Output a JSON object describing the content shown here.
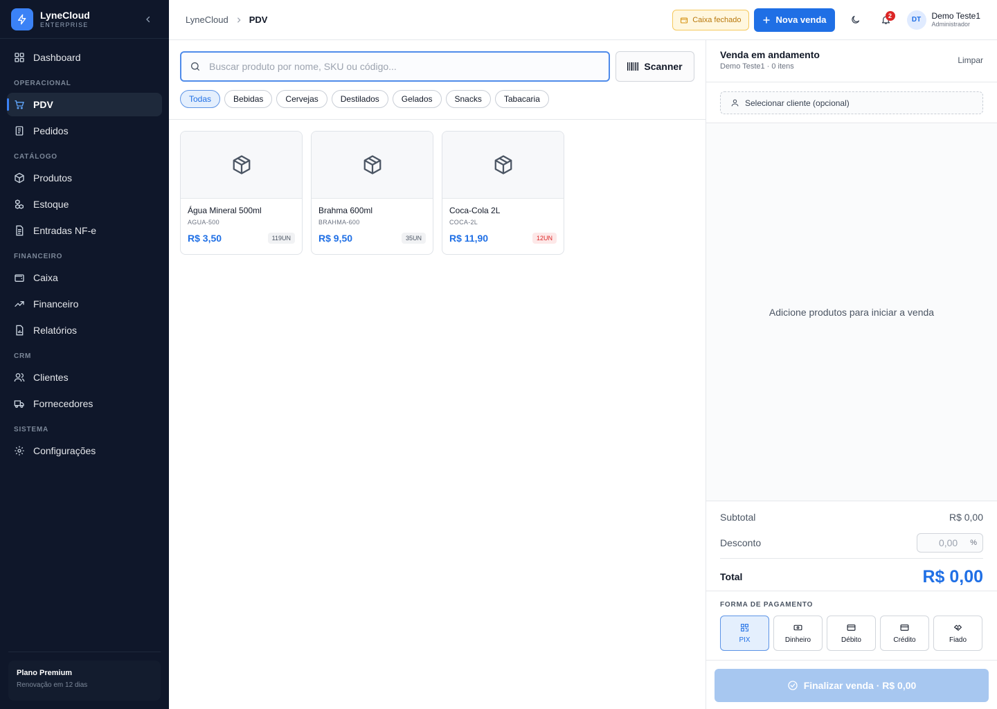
{
  "brand": {
    "name": "LyneCloud",
    "edition": "ENTERPRISE"
  },
  "sidebar": {
    "top_item": {
      "label": "Dashboard",
      "icon": "dashboard-icon"
    },
    "sections": [
      {
        "title": "OPERACIONAL",
        "items": [
          {
            "label": "PDV",
            "icon": "cart-icon",
            "active": true
          },
          {
            "label": "Pedidos",
            "icon": "receipt-icon"
          }
        ]
      },
      {
        "title": "CATÁLOGO",
        "items": [
          {
            "label": "Produtos",
            "icon": "box-icon"
          },
          {
            "label": "Estoque",
            "icon": "boxes-icon"
          },
          {
            "label": "Entradas NF-e",
            "icon": "document-icon"
          }
        ]
      },
      {
        "title": "FINANCEIRO",
        "items": [
          {
            "label": "Caixa",
            "icon": "wallet-icon"
          },
          {
            "label": "Financeiro",
            "icon": "trend-icon"
          },
          {
            "label": "Relatórios",
            "icon": "report-icon"
          }
        ]
      },
      {
        "title": "CRM",
        "items": [
          {
            "label": "Clientes",
            "icon": "users-icon"
          },
          {
            "label": "Fornecedores",
            "icon": "truck-icon"
          }
        ]
      },
      {
        "title": "SISTEMA",
        "items": [
          {
            "label": "Configurações",
            "icon": "gear-icon"
          }
        ]
      }
    ],
    "plan": {
      "title": "Plano Premium",
      "renewal": "Renovação em 12 dias"
    }
  },
  "header": {
    "breadcrumb": [
      "LyneCloud",
      "PDV"
    ],
    "caixa_status": "Caixa fechado",
    "new_sale_label": "Nova venda",
    "notification_count": "2",
    "user": {
      "initials": "DT",
      "name": "Demo Teste1",
      "role": "Administrador"
    }
  },
  "search": {
    "placeholder": "Buscar produto por nome, SKU ou código...",
    "value": "",
    "scanner_label": "Scanner"
  },
  "categories": [
    {
      "label": "Todas",
      "active": true
    },
    {
      "label": "Bebidas"
    },
    {
      "label": "Cervejas"
    },
    {
      "label": "Destilados"
    },
    {
      "label": "Gelados"
    },
    {
      "label": "Snacks"
    },
    {
      "label": "Tabacaria"
    }
  ],
  "products": [
    {
      "name": "Água Mineral 500ml",
      "sku": "AGUA-500",
      "price": "R$ 3,50",
      "stock": "119UN",
      "low": false
    },
    {
      "name": "Brahma 600ml",
      "sku": "BRAHMA-600",
      "price": "R$ 9,50",
      "stock": "35UN",
      "low": false
    },
    {
      "name": "Coca-Cola 2L",
      "sku": "COCA-2L",
      "price": "R$ 11,90",
      "stock": "12UN",
      "low": true
    }
  ],
  "cart": {
    "title": "Venda em andamento",
    "subtitle": "Demo Teste1 · 0 itens",
    "clear_label": "Limpar",
    "client_placeholder": "Selecionar cliente (opcional)",
    "empty_message": "Adicione produtos para iniciar a venda",
    "subtotal_label": "Subtotal",
    "subtotal_value": "R$ 0,00",
    "discount_label": "Desconto",
    "discount_value": "0,00",
    "discount_unit": "%",
    "total_label": "Total",
    "total_value": "R$ 0,00",
    "payment_title": "FORMA DE PAGAMENTO",
    "payment_methods": [
      {
        "label": "PIX",
        "icon": "qr-icon",
        "active": true
      },
      {
        "label": "Dinheiro",
        "icon": "cash-icon"
      },
      {
        "label": "Débito",
        "icon": "card-icon"
      },
      {
        "label": "Crédito",
        "icon": "card-icon"
      },
      {
        "label": "Fiado",
        "icon": "handshake-icon"
      }
    ],
    "finalize_label": "Finalizar venda · R$ 0,00"
  },
  "colors": {
    "accent": "#1f6fe5",
    "sidebar_bg": "#0f172a",
    "warning": "#b8770a",
    "danger": "#dc2626"
  }
}
